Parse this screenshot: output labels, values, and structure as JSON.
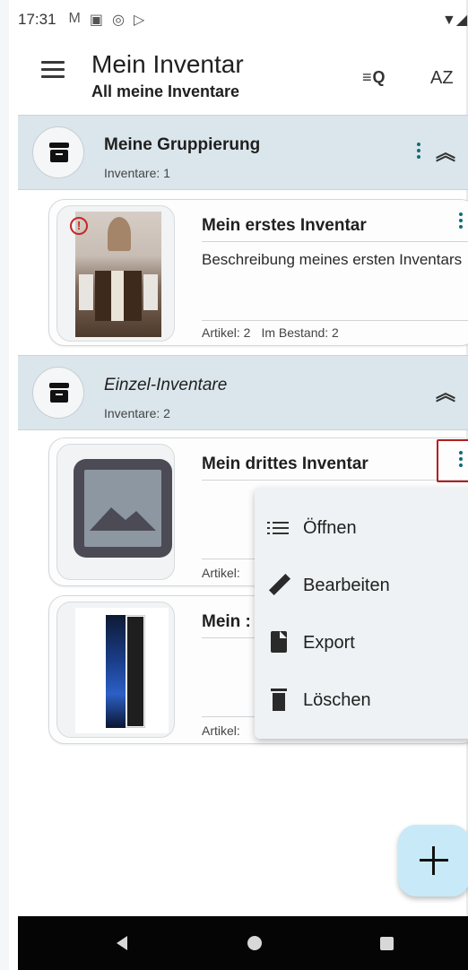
{
  "status_bar": {
    "time": "17:31",
    "notification_icons": [
      "M",
      "▣",
      "◎",
      "▷"
    ],
    "right_icons": "▼◢▮"
  },
  "app_bar": {
    "title": "Mein Inventar",
    "subtitle": "All meine Inventare",
    "menu_icon": "hamburger-icon",
    "search_sort_label": "≡Q",
    "az_sort_label": "AZ"
  },
  "groups": [
    {
      "name": "Meine Gruppierung",
      "count_label": "Inventare: 1",
      "italic": false,
      "has_menu": true
    },
    {
      "name": "Einzel-Inventare",
      "count_label": "Inventare: 2",
      "italic": true,
      "has_menu": false
    }
  ],
  "inventories": [
    {
      "title": "Mein erstes Inventar",
      "description": "Beschreibung meines ersten Inventars",
      "stats_articles": "Artikel: 2",
      "stats_stock": "Im Bestand: 2",
      "image": "dining-room-photo",
      "alert_icon": "!"
    },
    {
      "title": "Mein drittes Inventar",
      "description": "",
      "stats_articles": "Artikel:",
      "image": "image-placeholder-icon"
    },
    {
      "title": "Mein :",
      "stats_articles": "Artikel:",
      "image": "pc-case-photo"
    }
  ],
  "context_menu": {
    "items": [
      {
        "label": "Öffnen",
        "icon": "list-icon"
      },
      {
        "label": "Bearbeiten",
        "icon": "pencil-icon"
      },
      {
        "label": "Export",
        "icon": "export-doc-icon"
      },
      {
        "label": "Löschen",
        "icon": "trash-icon"
      }
    ]
  },
  "fab": {
    "icon": "plus-icon"
  },
  "colors": {
    "group_header_bg": "#dbe6ec",
    "accent_dots": "#0f6d78",
    "fab_bg": "#c8e9f7",
    "highlight_border": "#b71c1c",
    "alert": "#c62828"
  }
}
